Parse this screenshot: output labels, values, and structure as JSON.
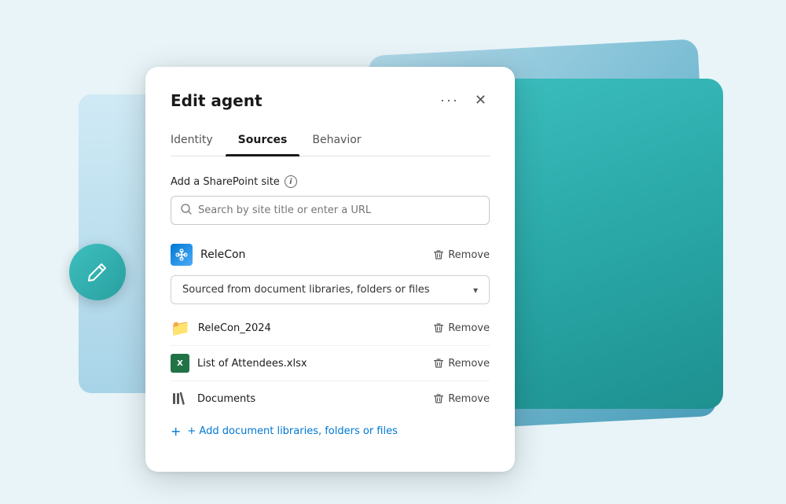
{
  "background": {
    "colors": {
      "bg": "#e8f4f8",
      "card_back": "#7bbdd4",
      "card_teal": "#2aa8a8",
      "card_left": "#d0eaf5",
      "pencil_circle": "#3dbfbf"
    }
  },
  "dialog": {
    "title": "Edit agent",
    "more_label": "···",
    "close_label": "✕",
    "tabs": [
      {
        "id": "identity",
        "label": "Identity",
        "active": false
      },
      {
        "id": "sources",
        "label": "Sources",
        "active": true
      },
      {
        "id": "behavior",
        "label": "Behavior",
        "active": false
      }
    ],
    "section_label": "Add a SharePoint site",
    "search_placeholder": "Search by site title or enter a URL",
    "site": {
      "name": "ReleCon",
      "remove_label": "Remove"
    },
    "dropdown_label": "Sourced from document libraries, folders or files",
    "files": [
      {
        "id": "folder",
        "name": "ReleCon_2024",
        "type": "folder",
        "remove_label": "Remove"
      },
      {
        "id": "excel",
        "name": "List of Attendees.xlsx",
        "type": "excel",
        "remove_label": "Remove"
      },
      {
        "id": "library",
        "name": "Documents",
        "type": "library",
        "remove_label": "Remove"
      }
    ],
    "add_label": "+ Add document libraries, folders or files"
  }
}
